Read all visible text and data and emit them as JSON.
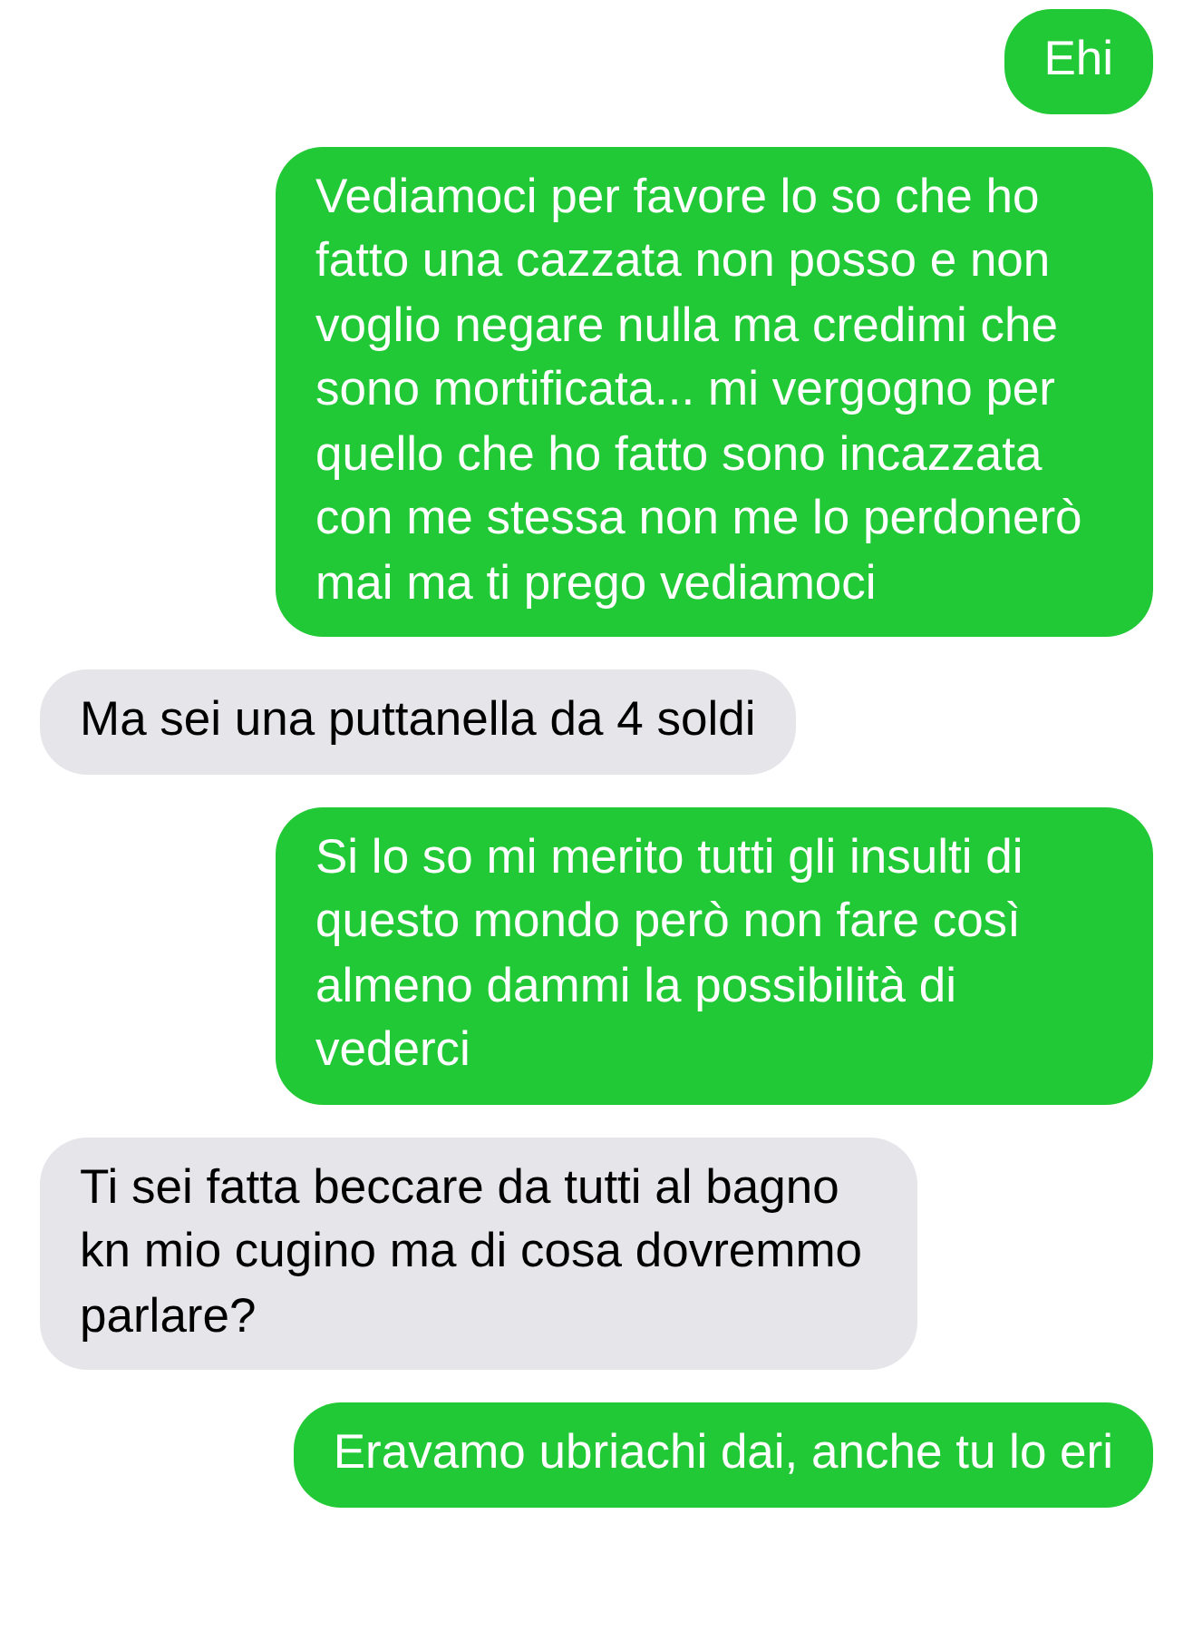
{
  "messages": [
    {
      "kind": "sent",
      "text": "Ehi"
    },
    {
      "kind": "sent",
      "text": "Vediamoci per favore lo so che ho fatto una cazzata non posso e non voglio negare nulla ma credimi che sono mortificata... mi vergogno per quello che ho fatto sono incazzata con me stessa non me lo perdonerò mai ma ti prego vediamoci"
    },
    {
      "kind": "received",
      "text": "Ma sei una puttanella da 4 soldi"
    },
    {
      "kind": "sent",
      "text": "Si lo so mi merito tutti gli insulti di questo mondo però non fare così almeno dammi la possibilità di vederci"
    },
    {
      "kind": "received",
      "text": "Ti sei fatta beccare da tutti al bagno kn mio cugino ma di cosa dovremmo parlare?"
    },
    {
      "kind": "sent",
      "text": "Eravamo ubriachi dai, anche tu lo eri"
    }
  ]
}
